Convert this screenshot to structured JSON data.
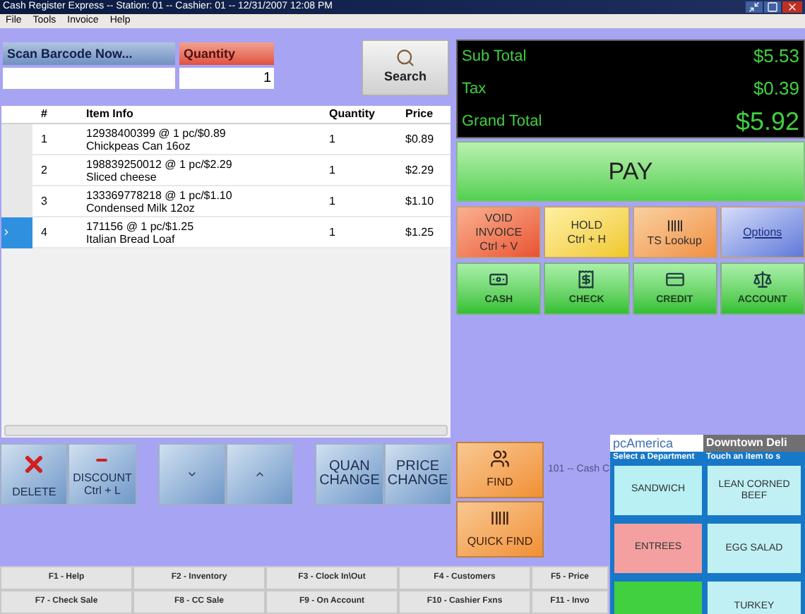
{
  "window": {
    "title": "Cash Register Express -- Station: 01 -- Cashier: 01 -- 12/31/2007 12:08 PM"
  },
  "menu": [
    "File",
    "Tools",
    "Invoice",
    "Help"
  ],
  "scan": {
    "label": "Scan Barcode Now..."
  },
  "quantity": {
    "label": "Quantity",
    "value": "1"
  },
  "search_button": "Search",
  "table": {
    "columns": [
      "#",
      "Item Info",
      "Quantity",
      "Price"
    ],
    "rows": [
      {
        "number": "1",
        "code": "12938400399 @ 1 pc/$0.89",
        "name": "Chickpeas Can 16oz",
        "quantity": "1",
        "price": "$0.89",
        "selected": false
      },
      {
        "number": "2",
        "code": "198839250012 @ 1 pc/$2.29",
        "name": "Sliced cheese",
        "quantity": "1",
        "price": "$2.29",
        "selected": false
      },
      {
        "number": "3",
        "code": "133369778218 @ 1 pc/$1.10",
        "name": "Condensed Milk 12oz",
        "quantity": "1",
        "price": "$1.10",
        "selected": false
      },
      {
        "number": "4",
        "code": "171156 @ 1 pc/$1.25",
        "name": "Italian Bread Loaf",
        "quantity": "1",
        "price": "$1.25",
        "selected": true
      }
    ]
  },
  "totals": [
    {
      "label": "Sub Total",
      "value": "$5.53",
      "kind": "normal"
    },
    {
      "label": "Tax",
      "value": "$0.39",
      "kind": "normal"
    },
    {
      "label": "Grand Total",
      "value": "$5.92",
      "kind": "grand"
    }
  ],
  "pay_button": "PAY",
  "actions": [
    {
      "kind": "void",
      "lines": [
        "VOID",
        "INVOICE",
        "Ctrl + V"
      ]
    },
    {
      "kind": "hold",
      "lines": [
        "HOLD",
        "Ctrl + H"
      ]
    },
    {
      "kind": "lookup",
      "lines": [
        "TS Lookup"
      ]
    },
    {
      "kind": "options",
      "lines": [
        "Options"
      ]
    }
  ],
  "tenders": [
    {
      "kind": "cash",
      "label": "CASH"
    },
    {
      "kind": "check",
      "label": "CHECK"
    },
    {
      "kind": "credit",
      "label": "CREDIT"
    },
    {
      "kind": "account",
      "label": "ACCOUNT"
    }
  ],
  "edit_buttons": [
    {
      "kind": "delete",
      "lines": [
        "DELETE"
      ]
    },
    {
      "kind": "discount",
      "lines": [
        "DISCOUNT",
        "Ctrl + L"
      ]
    },
    {
      "kind": "down"
    },
    {
      "kind": "up"
    },
    {
      "kind": "quan",
      "lines": [
        "QUAN",
        "CHANGE"
      ]
    },
    {
      "kind": "price",
      "lines": [
        "PRICE",
        "CHANGE"
      ]
    }
  ],
  "find_buttons": [
    {
      "kind": "find",
      "label": "FIND"
    },
    {
      "kind": "quick",
      "label": "QUICK FIND"
    }
  ],
  "status_text": "101 -- Cash C",
  "function_keys": [
    [
      "F1 - Help",
      "F2 - Inventory",
      "F3 - Clock In\\Out",
      "F4 - Customers",
      "F5 - Price"
    ],
    [
      "F7 - Check Sale",
      "F8 - CC Sale",
      "F9 - On Account",
      "F10 - Cashier Fxns",
      "F11 - Invo"
    ]
  ],
  "deli": {
    "logo": "pcAmerica",
    "title": "Downtown Deli",
    "left_header": "Select a Department",
    "right_header": "Touch an item to s",
    "departments": [
      {
        "label": "SANDWICH",
        "color": "#b8f0f4"
      },
      {
        "label": "ENTREES",
        "color": "#f4a0a0"
      },
      {
        "color": "#40d040"
      }
    ],
    "items": [
      "LEAN CORNED BEEF",
      "EGG SALAD",
      "TURKEY"
    ]
  }
}
